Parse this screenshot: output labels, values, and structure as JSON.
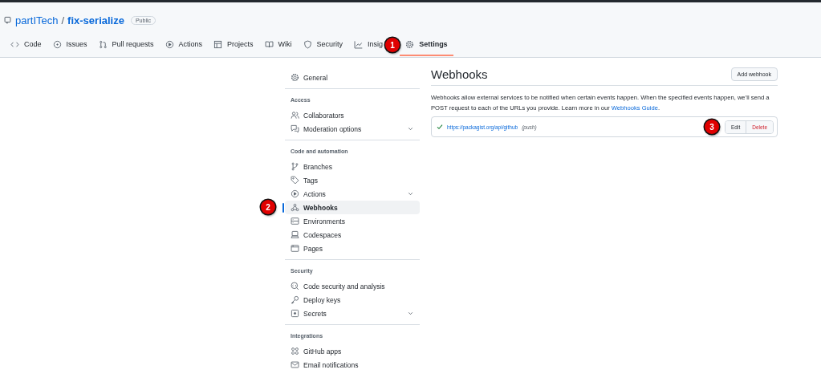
{
  "repo": {
    "owner": "partITech",
    "separator": "/",
    "name": "fix-serialize",
    "visibility": "Public"
  },
  "tabs": [
    {
      "label": "Code",
      "selected": false
    },
    {
      "label": "Issues",
      "selected": false
    },
    {
      "label": "Pull requests",
      "selected": false
    },
    {
      "label": "Actions",
      "selected": false
    },
    {
      "label": "Projects",
      "selected": false
    },
    {
      "label": "Wiki",
      "selected": false
    },
    {
      "label": "Security",
      "selected": false
    },
    {
      "label": "Insig",
      "selected": false
    },
    {
      "label": "Settings",
      "selected": true
    }
  ],
  "sidebar": {
    "sections": [
      {
        "items": [
          {
            "label": "General",
            "selected": false,
            "kind": "link"
          }
        ]
      },
      {
        "heading": "Access",
        "items": [
          {
            "label": "Collaborators",
            "selected": false,
            "kind": "link"
          },
          {
            "label": "Moderation options",
            "selected": false,
            "kind": "group"
          }
        ]
      },
      {
        "heading": "Code and automation",
        "items": [
          {
            "label": "Branches",
            "selected": false,
            "kind": "link"
          },
          {
            "label": "Tags",
            "selected": false,
            "kind": "link"
          },
          {
            "label": "Actions",
            "selected": false,
            "kind": "group"
          },
          {
            "label": "Webhooks",
            "selected": true,
            "kind": "link"
          },
          {
            "label": "Environments",
            "selected": false,
            "kind": "link"
          },
          {
            "label": "Codespaces",
            "selected": false,
            "kind": "link"
          },
          {
            "label": "Pages",
            "selected": false,
            "kind": "link"
          }
        ]
      },
      {
        "heading": "Security",
        "items": [
          {
            "label": "Code security and analysis",
            "selected": false,
            "kind": "link"
          },
          {
            "label": "Deploy keys",
            "selected": false,
            "kind": "link"
          },
          {
            "label": "Secrets",
            "selected": false,
            "kind": "group"
          }
        ]
      },
      {
        "heading": "Integrations",
        "items": [
          {
            "label": "GitHub apps",
            "selected": false,
            "kind": "link"
          },
          {
            "label": "Email notifications",
            "selected": false,
            "kind": "link"
          }
        ]
      }
    ]
  },
  "main": {
    "title": "Webhooks",
    "add_button": "Add webhook",
    "description": "Webhooks allow external services to be notified when certain events happen. When the specified events happen, we’ll send a POST request to each of the URLs you provide. Learn more in our",
    "guide_link": "Webhooks Guide",
    "guide_end": ".",
    "webhooks": [
      {
        "url": "https://packagist.org/api/github",
        "events": "(push)",
        "ok": true,
        "edit": "Edit",
        "delete": "Delete"
      }
    ]
  },
  "callouts": [
    "1",
    "2",
    "3"
  ]
}
